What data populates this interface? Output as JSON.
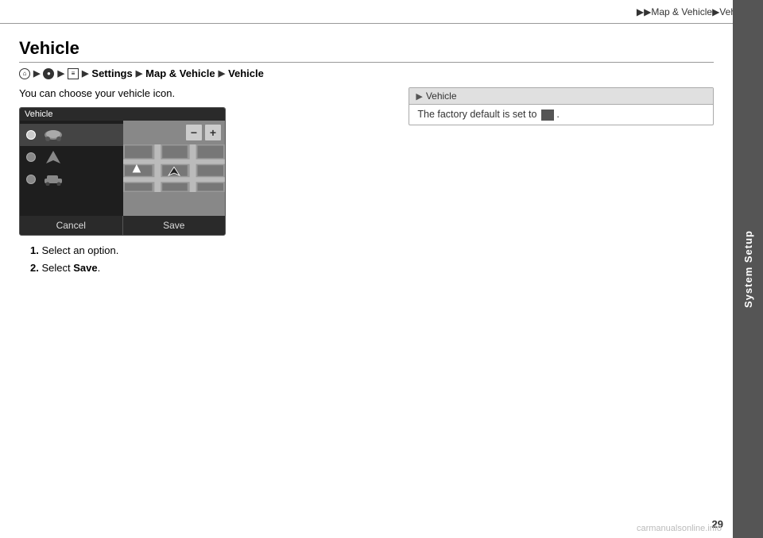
{
  "header": {
    "breadcrumb": "▶▶Map & Vehicle▶Vehicle"
  },
  "sidebar": {
    "label": "System Setup"
  },
  "page": {
    "title": "Vehicle",
    "number": "29"
  },
  "breadcrumb": {
    "items": [
      "Settings",
      "Map & Vehicle",
      "Vehicle"
    ]
  },
  "intro": "You can choose your vehicle icon.",
  "steps": [
    {
      "number": "1.",
      "text": "Select an option."
    },
    {
      "number": "2.",
      "text_prefix": "Select ",
      "bold": "Save",
      "text_suffix": "."
    }
  ],
  "vehicle_ui": {
    "header": "Vehicle",
    "controls": {
      "minus": "−",
      "plus": "+"
    },
    "buttons": {
      "cancel": "Cancel",
      "save": "Save"
    }
  },
  "info_box": {
    "header": "Vehicle",
    "body_text": "The factory default is set to",
    "body_suffix": "."
  }
}
